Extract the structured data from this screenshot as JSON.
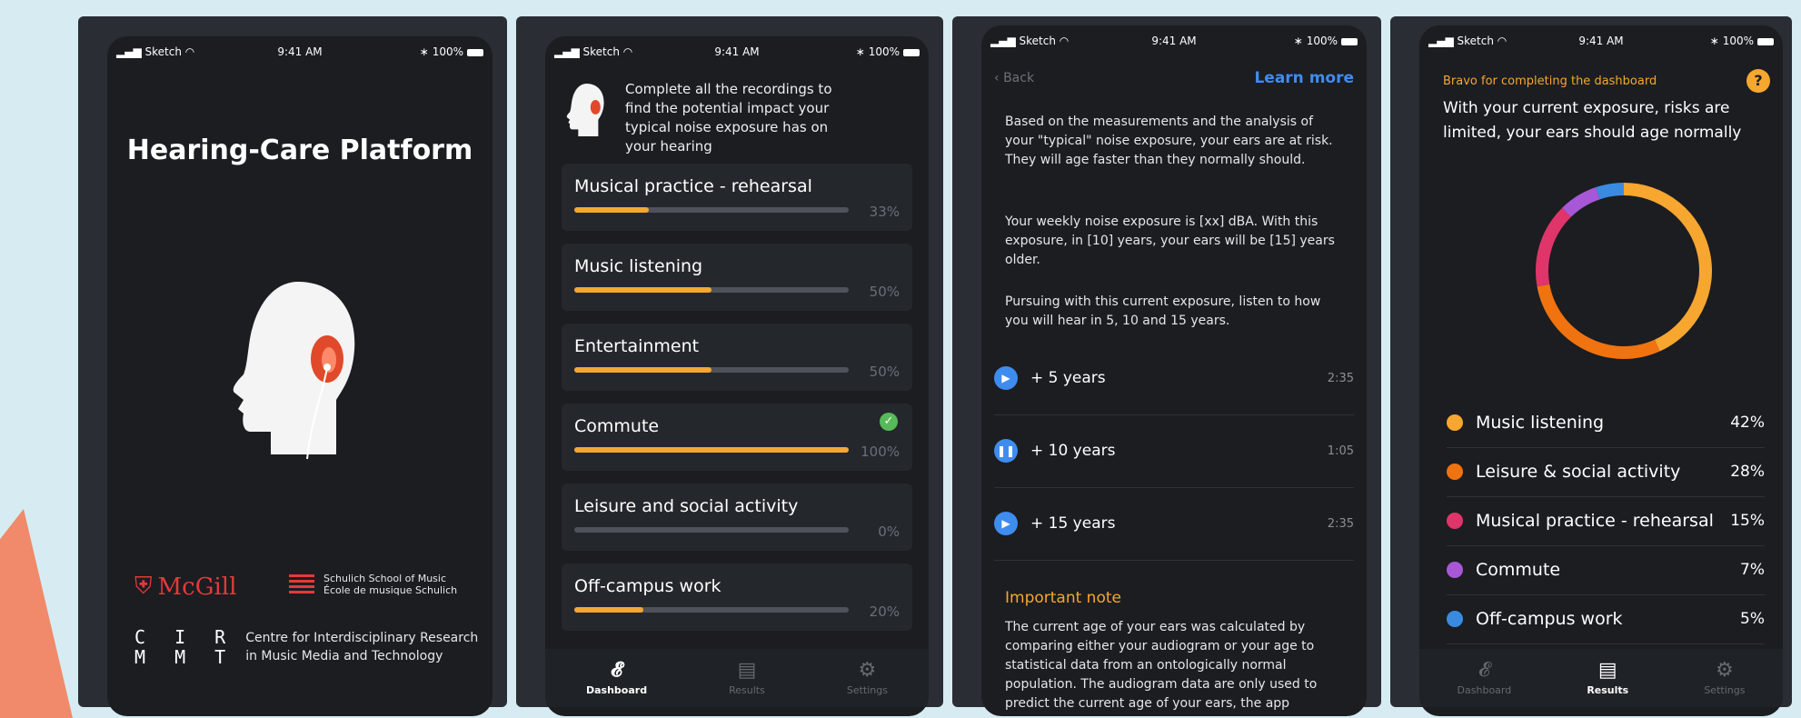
{
  "status": {
    "carrier": "Sketch",
    "time": "9:41 AM",
    "battery": "100%"
  },
  "screen1": {
    "title": "Hearing-Care Platform",
    "mcgill": "McGill",
    "schulich_line1": "Schulich School of Music",
    "schulich_line2": "École de musique Schulich",
    "cirmmt_line1": "C I R",
    "cirmmt_line2": "M M T",
    "cirmmt_text1": "Centre for Interdisciplinary Research",
    "cirmmt_text2": "in Music Media and Technology"
  },
  "screen2": {
    "intro": "Complete all the recordings to find the potential impact your typical noise exposure has on your hearing",
    "cards": [
      {
        "title": "Musical practice - rehearsal",
        "progress": 0.27,
        "pct": "33%"
      },
      {
        "title": "Music listening",
        "progress": 0.5,
        "pct": "50%"
      },
      {
        "title": "Entertainment",
        "progress": 0.5,
        "pct": "50%"
      },
      {
        "title": "Commute",
        "progress": 1.0,
        "pct": "100%",
        "complete": true
      },
      {
        "title": "Leisure and social activity",
        "progress": 0.0,
        "pct": "0%"
      },
      {
        "title": "Off-campus work",
        "progress": 0.25,
        "pct": "20%"
      }
    ],
    "tabs": [
      {
        "label": "Dashboard",
        "icon": "ear-icon"
      },
      {
        "label": "Results",
        "icon": "results-icon"
      },
      {
        "label": "Settings",
        "icon": "gear-icon"
      }
    ]
  },
  "screen3": {
    "back": "Back",
    "learn_more": "Learn more",
    "p1": "Based on the measurements and the analysis of your \"typical\" noise exposure, your ears are at risk. They will age faster than they normally should.",
    "p2": "Your weekly noise exposure is [xx] dBA. With this exposure, in [10] years, your ears will be [15] years older.",
    "p3": "Pursuing with this current exposure, listen to how you will hear in 5, 10 and 15 years.",
    "tracks": [
      {
        "label": "+ 5 years",
        "time": "2:35",
        "state": "play"
      },
      {
        "label": "+ 10 years",
        "time": "1:05",
        "state": "pause"
      },
      {
        "label": "+ 15 years",
        "time": "2:35",
        "state": "play"
      }
    ],
    "note_heading": "Important note",
    "note_text": "The current age of your ears was calculated by comparing either your audiogram or your age to statistical data from an ontologically normal population. The audiogram data are only used to predict the current age of your ears, the app"
  },
  "screen4": {
    "subtitle": "Bravo for completing the dashboard",
    "help": "?",
    "text": "With your current exposure, risks are limited, your ears should age normally",
    "legend": [
      {
        "label": "Music listening",
        "pct": "42%",
        "value": 42,
        "color": "#f7a630"
      },
      {
        "label": "Leisure & social activity",
        "pct": "28%",
        "value": 28,
        "color": "#f0730f"
      },
      {
        "label": "Musical practice - rehearsal",
        "pct": "15%",
        "value": 15,
        "color": "#e0356a"
      },
      {
        "label": "Commute",
        "pct": "7%",
        "value": 7,
        "color": "#a857d6"
      },
      {
        "label": "Off-campus work",
        "pct": "5%",
        "value": 5,
        "color": "#3a8be0"
      }
    ]
  }
}
